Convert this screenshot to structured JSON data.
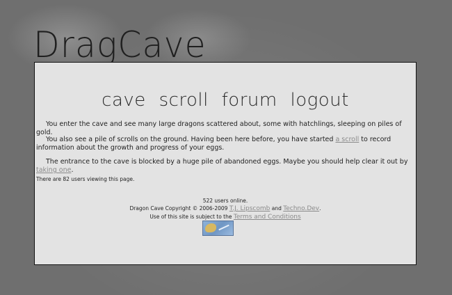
{
  "logo": {
    "text": "DragCave"
  },
  "nav": [
    {
      "label": "cave"
    },
    {
      "label": "scroll"
    },
    {
      "label": "forum"
    },
    {
      "label": "logout"
    }
  ],
  "content": {
    "para1": "You enter the cave and see many large dragons scattered about, some with hatchlings, sleeping on piles of gold.",
    "para2_before": "You also see a pile of scrolls on the ground. Having been here before, you have started ",
    "para2_link": "a scroll",
    "para2_after": " to record information about the growth and progress of your eggs.",
    "para3_before": "The entrance to the cave is blocked by a huge pile of abandoned eggs. Maybe you should help clear it out by ",
    "para3_link": "taking one",
    "para3_after": "."
  },
  "viewers": "There are 82 users viewing this page.",
  "footer": {
    "online": "522 users online.",
    "copyright": "Dragon Cave Copyright © 2006-2009 ",
    "author_link": "T.J. Lipscomb",
    "and": " and ",
    "techno_link": "Techno.Dev",
    "period": ".",
    "terms_before": "Use of this site is subject to the ",
    "terms_link": "Terms and Conditions"
  }
}
